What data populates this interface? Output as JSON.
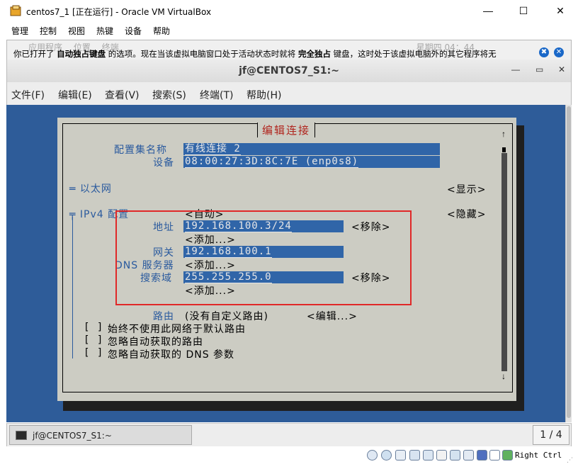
{
  "window": {
    "title": "centos7_1 [正在运行] - Oracle VM VirtualBox",
    "minimize": "—",
    "maximize": "☐",
    "close": "✕"
  },
  "vb_menu": [
    "管理",
    "控制",
    "视图",
    "热键",
    "设备",
    "帮助"
  ],
  "notification": {
    "behind_text": "应用程序　 位置　 终端　　　　　　　　　　　　　　　　　　　　　　　　　　　　　　　　　　　星期四 04：44",
    "part1": "你已打开了 ",
    "bold1": "自动独占键盘",
    "part2": " 的选项。现在当该虚拟电脑窗口处于活动状态时就将 ",
    "bold2": "完全独占",
    "part3": " 键盘，这时处于该虚拟电脑外的其它程序将无"
  },
  "terminal": {
    "title": "jf@CENTOS7_S1:~",
    "menu": [
      "文件(F)",
      "编辑(E)",
      "查看(V)",
      "搜索(S)",
      "终端(T)",
      "帮助(H)"
    ],
    "ctrl_min": "—",
    "ctrl_max": "▭",
    "ctrl_close": "✕"
  },
  "nmtui": {
    "dialog_title": "编辑连接",
    "profile_name_label": "配置集名称",
    "profile_name_value": "有线连接 2",
    "device_label": "设备",
    "device_value": "08:00:27:3D:8C:7E (enp0s8)",
    "ethernet_label": "═ 以太网",
    "ethernet_action": "<显示>",
    "ipv4_label": "╤ IPv4 配置",
    "ipv4_mode": "<自动>",
    "ipv4_action": "<隐藏>",
    "address_label": "地址",
    "address_value": "192.168.100.3/24",
    "remove_label": "<移除>",
    "add_label": "<添加...>",
    "gateway_label": "网关",
    "gateway_value": "192.168.100.1",
    "dns_label": "DNS 服务器",
    "search_label": "搜索域",
    "search_value": "255.255.255.0",
    "routing_label": "路由",
    "routing_value": "(没有自定义路由)",
    "edit_label": "<编辑...>",
    "checkboxes": [
      {
        "box": "[ ]",
        "label": "始终不使用此网络于默认路由"
      },
      {
        "box": "[ ]",
        "label": "忽略自动获取的路由"
      },
      {
        "box": "[ ]",
        "label": "忽略自动获取的 DNS 参数"
      }
    ],
    "scroll_up": "↑",
    "scroll_down": "↓"
  },
  "taskbar": {
    "task_label": "jf@CENTOS7_S1:~",
    "pager": "1 / 4"
  },
  "statusbar": {
    "host_key": "Right Ctrl",
    "icons": [
      "hard-disk-icon",
      "optical-drive-icon",
      "audio-icon",
      "network-icon",
      "usb-icon",
      "shared-folder-icon",
      "display-icon",
      "video-capture-icon",
      "virtualization-icon",
      "mouse-integration-icon",
      "keyboard-capture-icon"
    ]
  },
  "colors": {
    "terminal_bg": "#2e5c99",
    "dialog_bg": "#ccccc3",
    "field_bg": "#3065a8",
    "dialog_title": "#b0241d",
    "highlight_box": "#e02828"
  }
}
